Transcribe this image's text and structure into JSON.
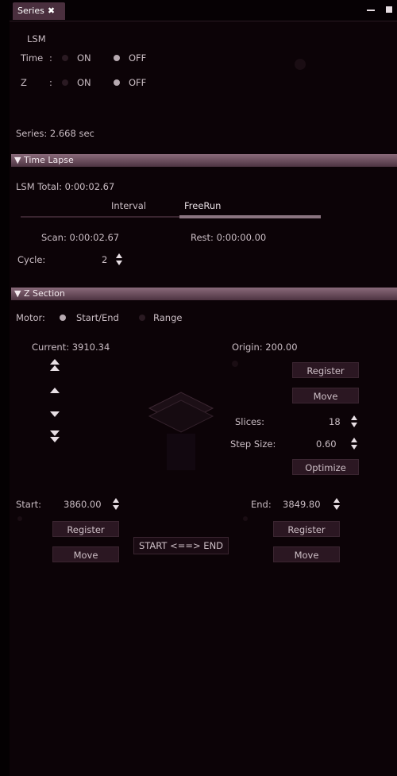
{
  "tab": {
    "label": "Series",
    "close": "✖"
  },
  "series": {
    "lsm_label": "LSM",
    "time_label": "Time",
    "z_label": "Z",
    "on_label": "ON",
    "off_label": "OFF",
    "series_time": "Series: 2.668 sec"
  },
  "time_lapse": {
    "header": "Time Lapse",
    "lsm_total": "LSM Total: 0:00:02.67",
    "tab_interval": "Interval",
    "tab_freerun": "FreeRun",
    "scan": "Scan: 0:00:02.67",
    "rest": "Rest: 0:00:00.00",
    "cycle_label": "Cycle:",
    "cycle_value": "2"
  },
  "z_section": {
    "header": "Z Section",
    "motor_label": "Motor:",
    "start_end_label": "Start/End",
    "range_label": "Range",
    "current": "Current: 3910.34",
    "origin": "Origin: 200.00",
    "register_label": "Register",
    "move_label": "Move",
    "slices_label": "Slices:",
    "slices_value": "18",
    "step_size_label": "Step Size:",
    "step_size_value": "0.60",
    "optimize_label": "Optimize",
    "start_label": "Start:",
    "start_value": "3860.00",
    "end_label": "End:",
    "end_value": "3849.80",
    "start_end_button": "START <==> END"
  },
  "colors": {
    "background": "#0c0307",
    "section_header": "#6b4a5a",
    "button": "#2b1722",
    "text": "#c9bcc3"
  }
}
